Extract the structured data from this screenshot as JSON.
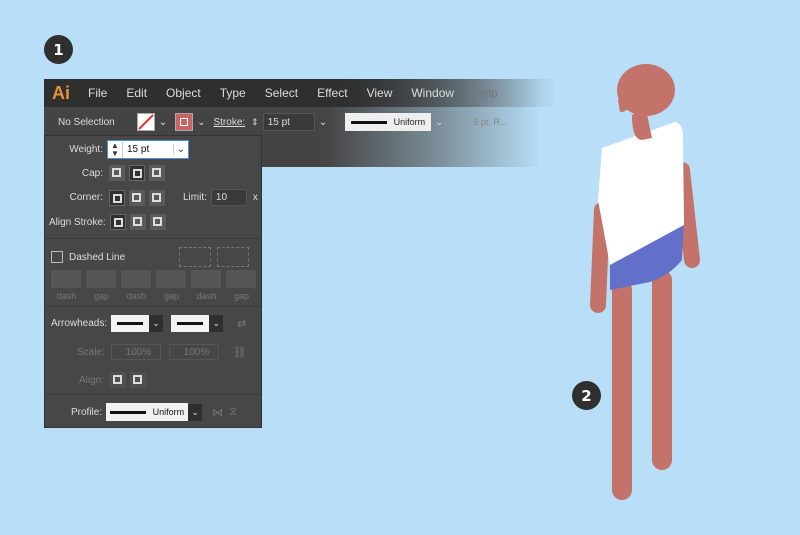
{
  "steps": {
    "one": "1",
    "two": "2"
  },
  "app": {
    "logo": "Ai",
    "menu": [
      "File",
      "Edit",
      "Object",
      "Type",
      "Select",
      "Effect",
      "View",
      "Window",
      "Help"
    ]
  },
  "control_bar": {
    "selection": "No Selection",
    "stroke_label": "Stroke:",
    "stroke_weight": "15 pt",
    "profile": "Uniform",
    "brush": "5 pt. R..."
  },
  "stroke_panel": {
    "weight_label": "Weight:",
    "weight_value": "15 pt",
    "cap_label": "Cap:",
    "corner_label": "Corner:",
    "limit_label": "Limit:",
    "limit_value": "10",
    "limit_unit": "x",
    "align_label": "Align Stroke:",
    "dashed_label": "Dashed Line",
    "dash_labels": [
      "dash",
      "gap",
      "dash",
      "gap",
      "dash",
      "gap"
    ],
    "arrowheads_label": "Arrowheads:",
    "scale_label": "Scale:",
    "scale_values": [
      "100%",
      "100%"
    ],
    "align_arrow_label": "Align:",
    "profile_label": "Profile:",
    "profile_value": "Uniform"
  },
  "colors": {
    "background": "#b8dff7",
    "skin": "#c4736a",
    "shirt": "#ffffff",
    "shorts": "#6370c9",
    "panel": "#474747",
    "accent": "#e8903a"
  }
}
